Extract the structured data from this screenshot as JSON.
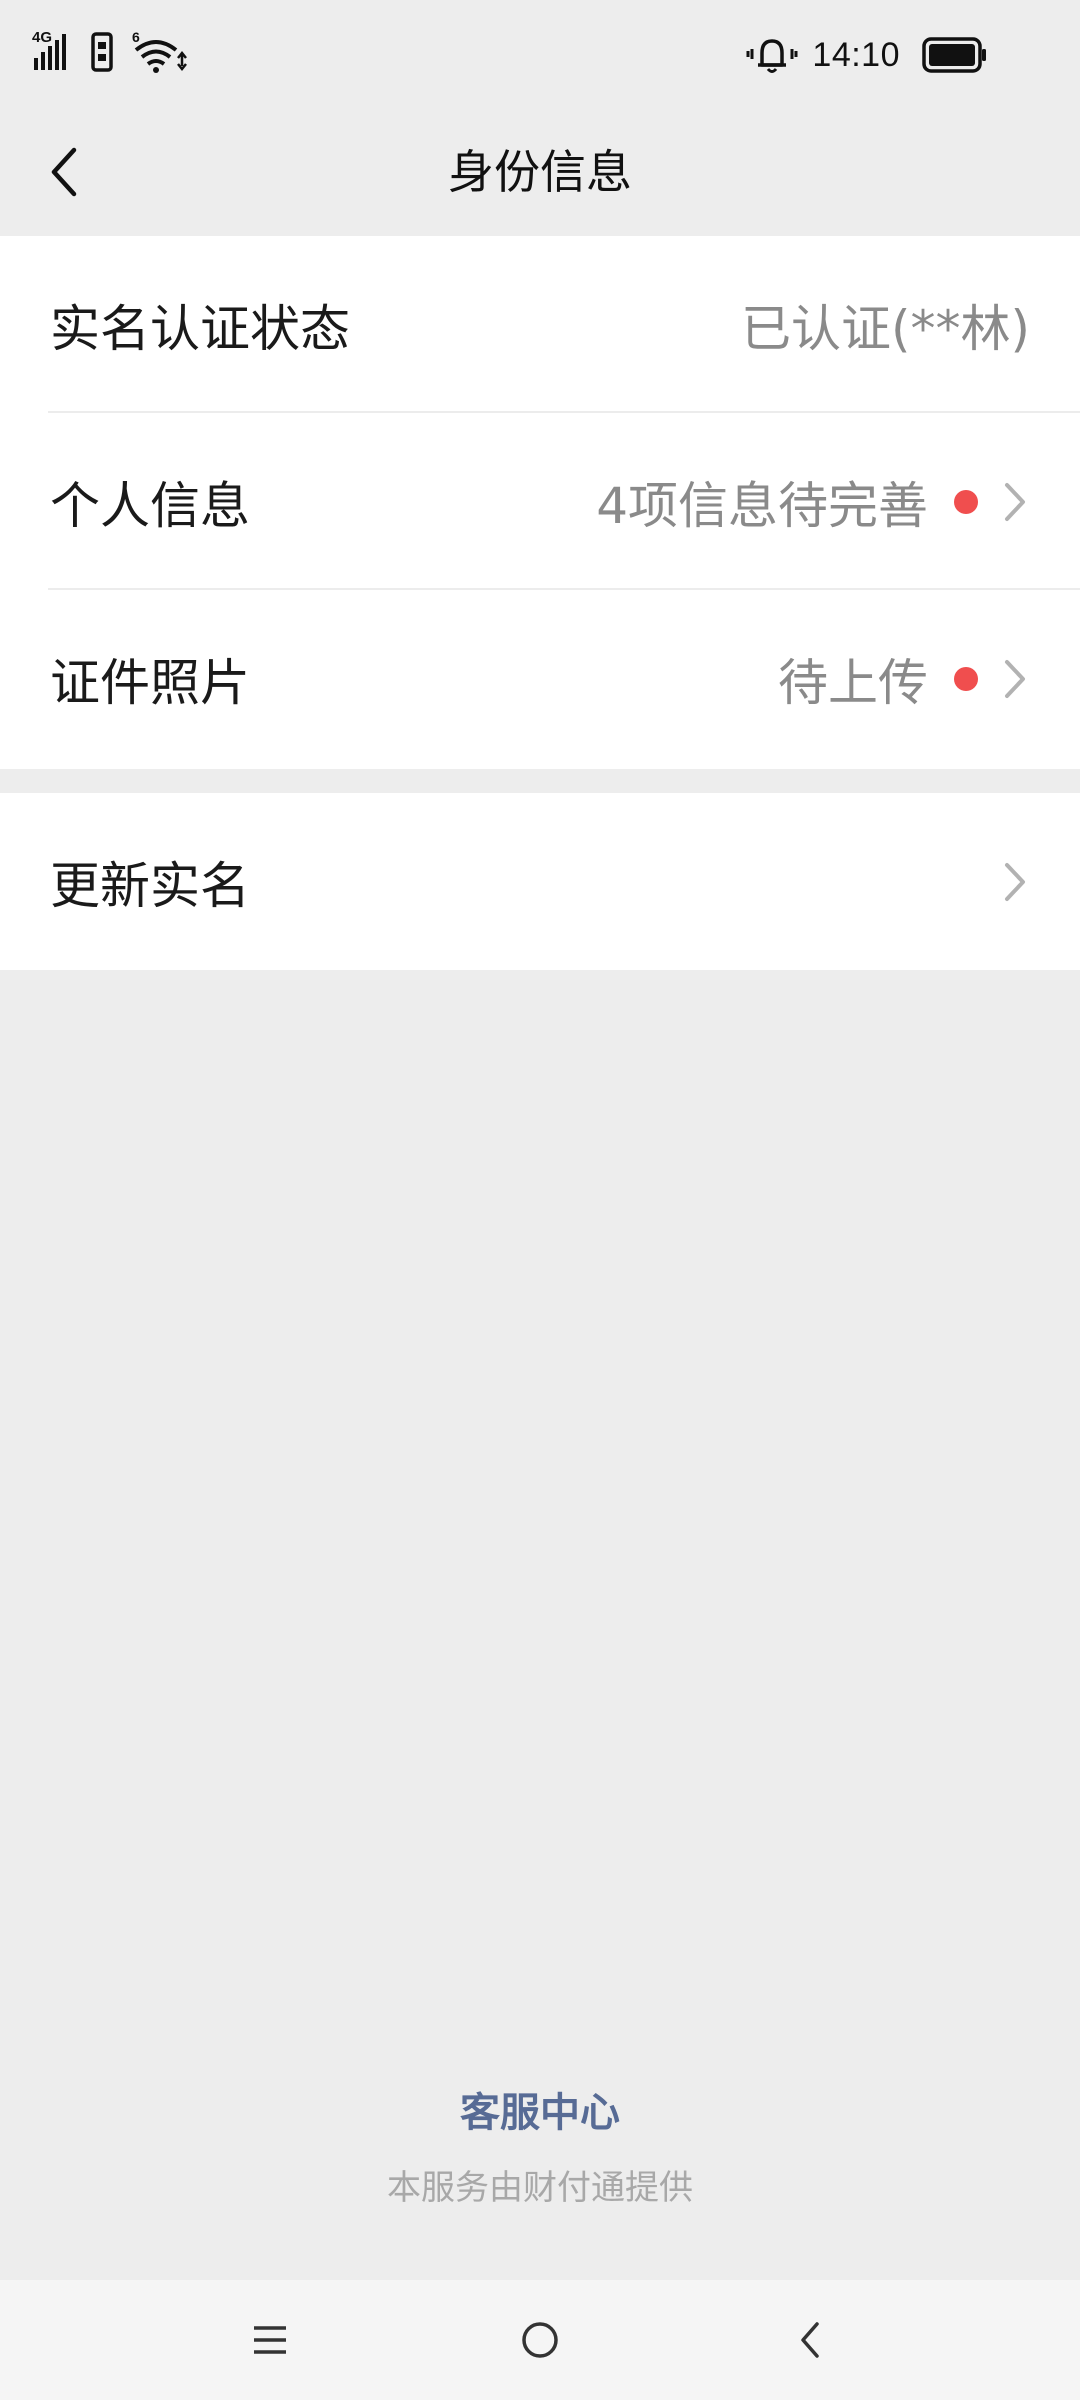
{
  "status_bar": {
    "network": "4G",
    "wifi_badge": "6",
    "time": "14:10",
    "icons": [
      "signal-4g-icon",
      "sim-icon",
      "wifi-6-icon",
      "vibrate-bell-icon",
      "battery-icon"
    ]
  },
  "nav": {
    "title": "身份信息",
    "back_icon": "chevron-left-icon"
  },
  "rows": [
    {
      "label": "实名认证状态",
      "value": "已认证(**林)",
      "dot": false,
      "chevron": false
    },
    {
      "label": "个人信息",
      "value": "4项信息待完善",
      "dot": true,
      "chevron": true
    },
    {
      "label": "证件照片",
      "value": "待上传",
      "dot": true,
      "chevron": true
    }
  ],
  "update_row": {
    "label": "更新实名",
    "chevron": true
  },
  "footer": {
    "link": "客服中心",
    "note": "本服务由财付通提供"
  },
  "system_nav": {
    "buttons": [
      "menu-icon",
      "home-icon",
      "back-icon"
    ]
  },
  "colors": {
    "background": "#ededed",
    "card": "#ffffff",
    "red_dot": "#f04e4e",
    "link": "#576b95",
    "secondary_text": "#8a8a8a"
  }
}
